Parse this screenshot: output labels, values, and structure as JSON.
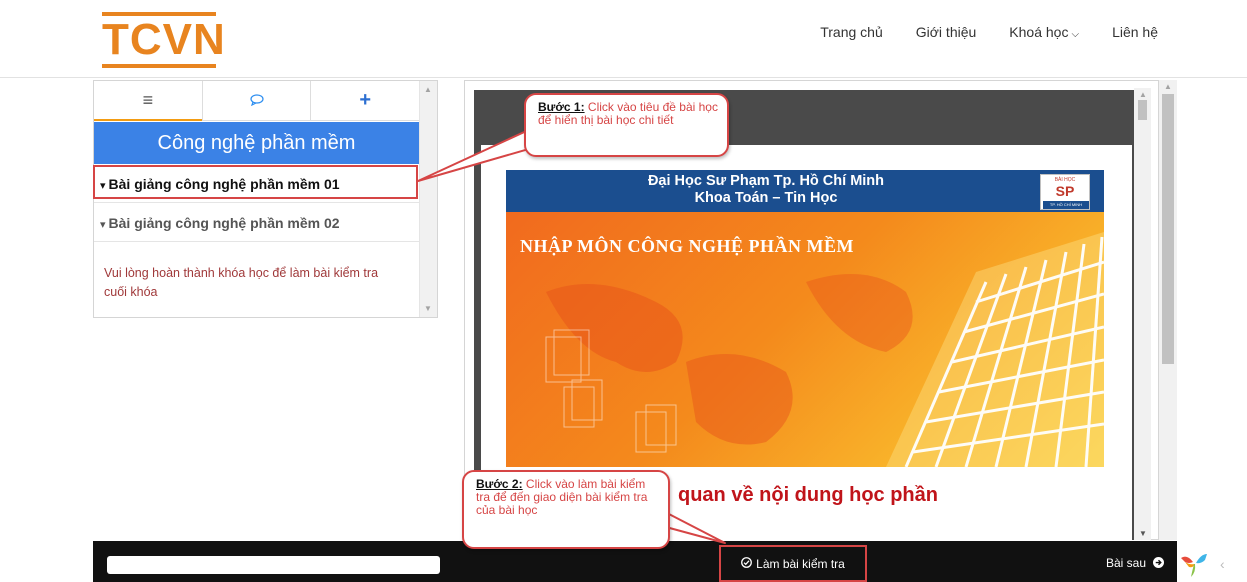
{
  "header": {
    "logo_text": "TCVN",
    "nav": [
      {
        "label": "Trang chủ"
      },
      {
        "label": "Giới thiệu"
      },
      {
        "label": "Khoá học",
        "has_dropdown": true
      },
      {
        "label": "Liên hệ"
      }
    ]
  },
  "sidebar": {
    "tabs": [
      {
        "icon": "list-icon",
        "glyph": "≡",
        "active": true
      },
      {
        "icon": "chat-icon",
        "glyph": "○"
      },
      {
        "icon": "plus-icon",
        "glyph": "+"
      }
    ],
    "course_title": "Công nghệ phần mềm",
    "lessons": [
      {
        "label": "Bài giảng công nghệ phần mềm 01"
      },
      {
        "label": "Bài giảng công nghệ phần mềm 02"
      }
    ],
    "notice": "Vui lòng hoàn thành khóa học để làm bài kiểm tra cuối khóa"
  },
  "slide": {
    "university": "Đại Học Sư Phạm Tp. Hồ Chí Minh",
    "faculty": "Khoa Toán – Tin Học",
    "logo_top": "BÀI HỌC",
    "logo_main": "SP",
    "logo_bottom": "TP. HỒ CHÍ MINH",
    "title": "NHẬP MÔN CÔNG NGHỆ PHẦN MỀM",
    "subtitle": "quan về nội dung học phần"
  },
  "bottombar": {
    "quiz_label": "Làm bài kiểm tra",
    "next_label": "Bài sau"
  },
  "callouts": {
    "step1_label": "Bước 1:",
    "step1_text": " Click vào tiêu đề bài học để hiển thị bài học chi tiết",
    "step2_label": "Bước 2:",
    "step2_text": " Click vào làm bài kiểm tra để đến giao diện bài kiểm tra của bài học"
  },
  "colors": {
    "brand_orange": "#e8841f",
    "course_blue": "#3b82e6",
    "highlight_red": "#d64545",
    "notice_red": "#a0393a",
    "slide_blue": "#1b4e8f"
  }
}
